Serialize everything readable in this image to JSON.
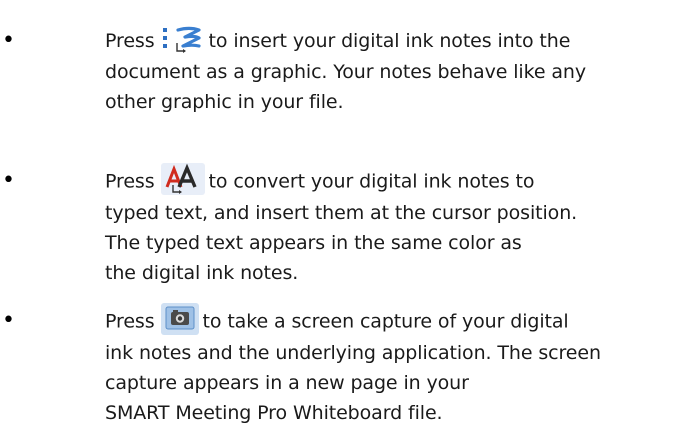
{
  "items": [
    {
      "press": "Press",
      "icon": "ink-to-graphic-icon",
      "first_rest": "to insert your digital ink notes into the",
      "lines": [
        "document as a graphic. Your notes behave like any",
        "other graphic in your file."
      ]
    },
    {
      "press": "Press",
      "icon": "convert-to-text-icon",
      "first_rest": "to convert your digital ink notes to",
      "lines": [
        "typed text, and insert them at the cursor position.",
        "The typed text appears in the same color as",
        "the digital ink notes."
      ]
    },
    {
      "press": "Press",
      "icon": "screen-capture-icon",
      "first_rest": "to take a screen capture of your digital",
      "lines": [
        "ink notes and the underlying application. The screen",
        "capture appears in a new page in your",
        "SMART Meeting Pro Whiteboard file."
      ]
    }
  ],
  "bullet_symbol": "•",
  "colors": {
    "text": "#1a1a1a",
    "icon_blue": "#3a7fd0",
    "icon_red": "#d02b1e"
  }
}
